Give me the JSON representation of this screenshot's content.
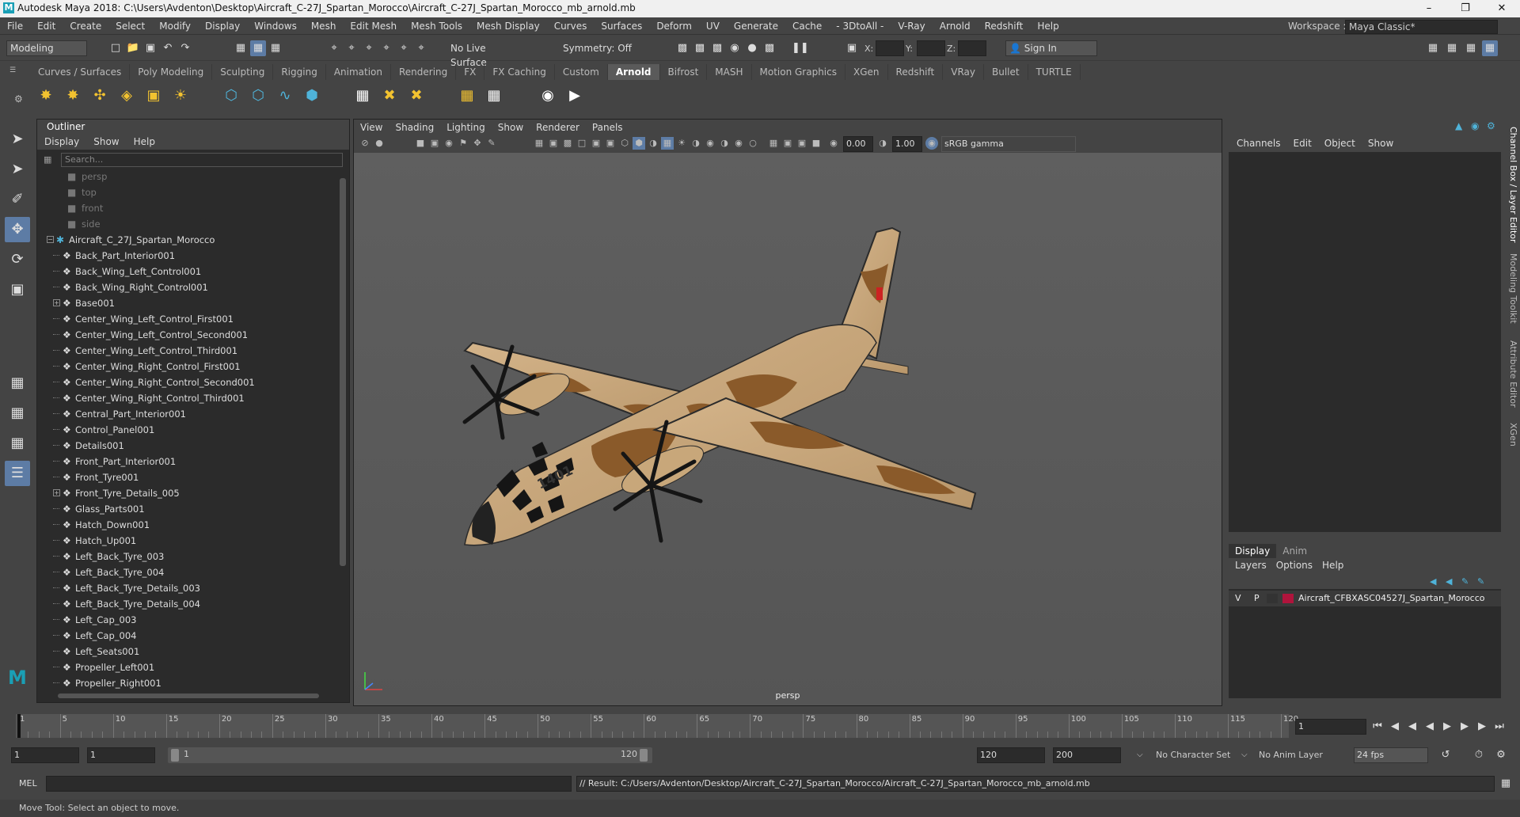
{
  "window": {
    "title": "Autodesk Maya 2018: C:\\Users\\Avdenton\\Desktop\\Aircraft_C-27J_Spartan_Morocco\\Aircraft_C-27J_Spartan_Morocco_mb_arnold.mb",
    "logo": "M"
  },
  "menubar": {
    "items": [
      "File",
      "Edit",
      "Create",
      "Select",
      "Modify",
      "Display",
      "Windows",
      "Mesh",
      "Edit Mesh",
      "Mesh Tools",
      "Mesh Display",
      "Curves",
      "Surfaces",
      "Deform",
      "UV",
      "Generate",
      "Cache",
      "- 3DtoAll -",
      "V-Ray",
      "Arnold",
      "Redshift",
      "Help"
    ]
  },
  "workspace": {
    "label": "Workspace :",
    "value": "Maya Classic*"
  },
  "statusline": {
    "mode": "Modeling",
    "live_surface": "No Live Surface",
    "symmetry": "Symmetry: Off",
    "x_label": "X:",
    "y_label": "Y:",
    "z_label": "Z:",
    "sign_in": "Sign In"
  },
  "shelf": {
    "tabs": [
      "Curves / Surfaces",
      "Poly Modeling",
      "Sculpting",
      "Rigging",
      "Animation",
      "Rendering",
      "FX",
      "FX Caching",
      "Custom",
      "Arnold",
      "Bifrost",
      "MASH",
      "Motion Graphics",
      "XGen",
      "Redshift",
      "VRay",
      "Bullet",
      "TURTLE"
    ],
    "active": "Arnold"
  },
  "outliner": {
    "title": "Outliner",
    "menu": [
      "Display",
      "Show",
      "Help"
    ],
    "search_placeholder": "Search...",
    "cameras": [
      "persp",
      "top",
      "front",
      "side"
    ],
    "root": "Aircraft_C_27J_Spartan_Morocco",
    "items": [
      {
        "name": "Back_Part_Interior001",
        "exp": false
      },
      {
        "name": "Back_Wing_Left_Control001",
        "exp": false
      },
      {
        "name": "Back_Wing_Right_Control001",
        "exp": false
      },
      {
        "name": "Base001",
        "exp": true
      },
      {
        "name": "Center_Wing_Left_Control_First001",
        "exp": false
      },
      {
        "name": "Center_Wing_Left_Control_Second001",
        "exp": false
      },
      {
        "name": "Center_Wing_Left_Control_Third001",
        "exp": false
      },
      {
        "name": "Center_Wing_Right_Control_First001",
        "exp": false
      },
      {
        "name": "Center_Wing_Right_Control_Second001",
        "exp": false
      },
      {
        "name": "Center_Wing_Right_Control_Third001",
        "exp": false
      },
      {
        "name": "Central_Part_Interior001",
        "exp": false
      },
      {
        "name": "Control_Panel001",
        "exp": false
      },
      {
        "name": "Details001",
        "exp": false
      },
      {
        "name": "Front_Part_Interior001",
        "exp": false
      },
      {
        "name": "Front_Tyre001",
        "exp": false
      },
      {
        "name": "Front_Tyre_Details_005",
        "exp": true
      },
      {
        "name": "Glass_Parts001",
        "exp": false
      },
      {
        "name": "Hatch_Down001",
        "exp": false
      },
      {
        "name": "Hatch_Up001",
        "exp": false
      },
      {
        "name": "Left_Back_Tyre_003",
        "exp": false
      },
      {
        "name": "Left_Back_Tyre_004",
        "exp": false
      },
      {
        "name": "Left_Back_Tyre_Details_003",
        "exp": false
      },
      {
        "name": "Left_Back_Tyre_Details_004",
        "exp": false
      },
      {
        "name": "Left_Cap_003",
        "exp": false
      },
      {
        "name": "Left_Cap_004",
        "exp": false
      },
      {
        "name": "Left_Seats001",
        "exp": false
      },
      {
        "name": "Propeller_Left001",
        "exp": false
      },
      {
        "name": "Propeller_Right001",
        "exp": false
      }
    ]
  },
  "viewport": {
    "menu": [
      "View",
      "Shading",
      "Lighting",
      "Show",
      "Renderer",
      "Panels"
    ],
    "field1": "0.00",
    "field2": "1.00",
    "color_space": "sRGB gamma",
    "camera_label": "persp",
    "aircraft_number": "1401"
  },
  "channelbox": {
    "menu": [
      "Channels",
      "Edit",
      "Object",
      "Show"
    ]
  },
  "layer_editor": {
    "tabs": [
      "Display",
      "Anim"
    ],
    "active": "Display",
    "menu": [
      "Layers",
      "Options",
      "Help"
    ],
    "layer": {
      "v": "V",
      "p": "P",
      "name": "Aircraft_CFBXASC04527J_Spartan_Morocco",
      "color": "#b0143c"
    }
  },
  "sidebar_tabs": [
    "Channel Box / Layer Editor",
    "Modeling Toolkit",
    "Attribute Editor",
    "XGen"
  ],
  "timeline": {
    "ticks": [
      "1",
      "5",
      "10",
      "15",
      "20",
      "25",
      "30",
      "35",
      "40",
      "45",
      "50",
      "55",
      "60",
      "65",
      "70",
      "75",
      "80",
      "85",
      "90",
      "95",
      "100",
      "105",
      "110",
      "115",
      "120"
    ],
    "current": "1"
  },
  "range": {
    "start": "1",
    "start2": "1",
    "slider_start": "1",
    "slider_end": "120",
    "end": "120",
    "end2": "200",
    "character_set": "No Character Set",
    "anim_layer": "No Anim Layer",
    "fps": "24 fps"
  },
  "cmdline": {
    "lang": "MEL",
    "result": "// Result: C:/Users/Avdenton/Desktop/Aircraft_C-27J_Spartan_Morocco/Aircraft_C-27J_Spartan_Morocco_mb_arnold.mb"
  },
  "helpline": {
    "text": "Move Tool: Select an object to move."
  },
  "colors": {
    "accent": "#5d7ca5",
    "panel": "#444444",
    "dark": "#2b2b2b",
    "camo_tan": "#c8a77a",
    "camo_brown": "#8a5a2a"
  }
}
